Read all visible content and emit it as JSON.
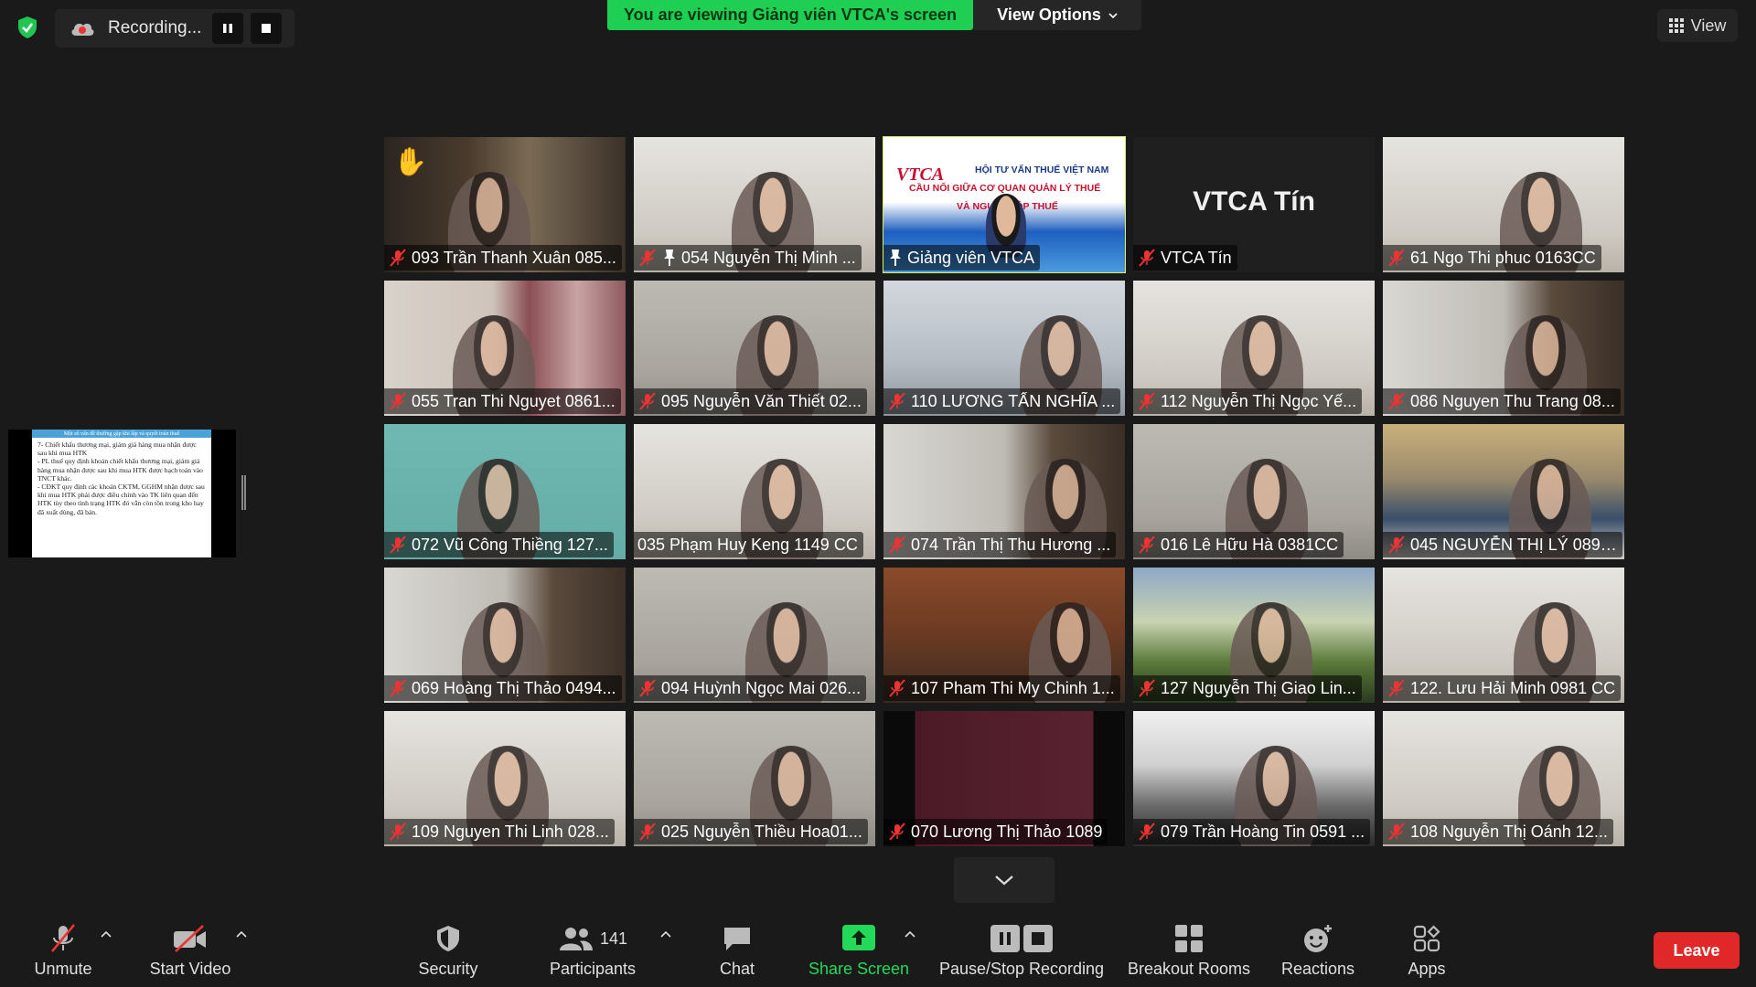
{
  "recording": {
    "label": "Recording..."
  },
  "banner": {
    "viewing_text": "You are viewing Giảng viên VTCA's screen",
    "view_options_label": "View Options"
  },
  "view_button": {
    "label": "View"
  },
  "shared_doc": {
    "header": "Một số vấn đề thường gặp khi lập và quyết toán thuế",
    "lines": [
      "7- Chiết khấu thương mại, giảm giá hàng mua nhận được sau khi mua HTK",
      "- PL thuế quy định khoản chiết khấu thương mại, giảm giá hàng mua nhận được sau khi mua HTK được hạch toán vào TNCT khác.",
      "- CĐKT quy định các khoản CKTM, GGHM nhận được sau khi mua HTK phải được điều chỉnh vào TK liên quan đến HTK tùy theo tình trạng HTK đó vẫn còn tồn trong kho hay đã xuất dùng, đã bán."
    ]
  },
  "speaker_slide": {
    "logo": "VTCA",
    "line1": "HỘI TƯ VẤN THUẾ VIỆT NAM",
    "line2": "CẦU NỐI GIỮA CƠ QUAN QUẢN LÝ THUẾ",
    "line3": "VÀ NGƯỜI NỘP THUẾ"
  },
  "participants": [
    {
      "name": "093 Trần Thanh Xuân 085...",
      "muted": true,
      "hand": true,
      "scene": "room-dark"
    },
    {
      "name": "054 Nguyễn Thị Minh ...",
      "muted": true,
      "pinned": true,
      "scene": "wall-light"
    },
    {
      "name": "Giảng viên VTCA",
      "muted": false,
      "pinned": true,
      "speaker": true,
      "scene": "slide"
    },
    {
      "name": "VTCA Tín",
      "muted": true,
      "video_off": true,
      "display_name": "VTCA Tín",
      "scene": "off"
    },
    {
      "name": "61 Ngo Thi phuc 0163CC",
      "muted": true,
      "scene": "wall-light"
    },
    {
      "name": "055 Tran Thi Nguyet 0861...",
      "muted": true,
      "scene": "room-curtain"
    },
    {
      "name": "095 Nguyễn Văn Thiết 02...",
      "muted": true,
      "scene": "wall-grey"
    },
    {
      "name": "110 LƯƠNG TẤN NGHĨA ...",
      "muted": true,
      "scene": "wall-blue"
    },
    {
      "name": "112 Nguyễn Thị Ngọc Yế...",
      "muted": true,
      "scene": "wall-light"
    },
    {
      "name": "086 Nguyen Thu Trang 08...",
      "muted": true,
      "scene": "room-shelf"
    },
    {
      "name": "072 Vũ Công Thiềng 127...",
      "muted": true,
      "scene": "teal"
    },
    {
      "name": "035 Phạm Huy Keng 1149 CC",
      "muted": false,
      "scene": "wall-light"
    },
    {
      "name": "074 Trần Thị Thu Hương ...",
      "muted": true,
      "scene": "room-shelf"
    },
    {
      "name": "016 Lê Hữu Hà 0381CC",
      "muted": true,
      "scene": "wall-grey"
    },
    {
      "name": "045 NGUYỄN THỊ LÝ 0890...",
      "muted": true,
      "scene": "room-painting"
    },
    {
      "name": "069 Hoàng Thị Thảo 0494...",
      "muted": true,
      "scene": "room-shelf"
    },
    {
      "name": "094 Huỳnh Ngọc Mai 026...",
      "muted": true,
      "scene": "wall-grey"
    },
    {
      "name": "107 Pham Thi My Chinh 1...",
      "muted": true,
      "scene": "room-wood"
    },
    {
      "name": "127 Nguyễn Thị Giao Lin...",
      "muted": true,
      "scene": "landscape"
    },
    {
      "name": "122. Lưu Hải Minh 0981 CC",
      "muted": true,
      "scene": "wall-light"
    },
    {
      "name": "109 Nguyen Thi Linh 028...",
      "muted": true,
      "scene": "wall-light"
    },
    {
      "name": "025 Nguyễn Thiều Hoa01...",
      "muted": true,
      "scene": "wall-grey"
    },
    {
      "name": "070 Lương Thị Thảo 1089",
      "muted": true,
      "scene": "dark-maroon"
    },
    {
      "name": "079 Trần Hoàng Tin 0591 ...",
      "muted": true,
      "scene": "window"
    },
    {
      "name": "108 Nguyễn Thị Oánh 12...",
      "muted": true,
      "scene": "wall-light"
    }
  ],
  "toolbar": {
    "unmute": "Unmute",
    "start_video": "Start Video",
    "security": "Security",
    "participants": "Participants",
    "participants_count": "141",
    "chat": "Chat",
    "share_screen": "Share Screen",
    "pause_stop_recording": "Pause/Stop Recording",
    "breakout_rooms": "Breakout Rooms",
    "reactions": "Reactions",
    "apps": "Apps",
    "leave": "Leave"
  },
  "colors": {
    "accent_green": "#23d959",
    "leave_red": "#e02828",
    "speaker_outline": "#d9f26b",
    "mute_red": "#e33"
  }
}
